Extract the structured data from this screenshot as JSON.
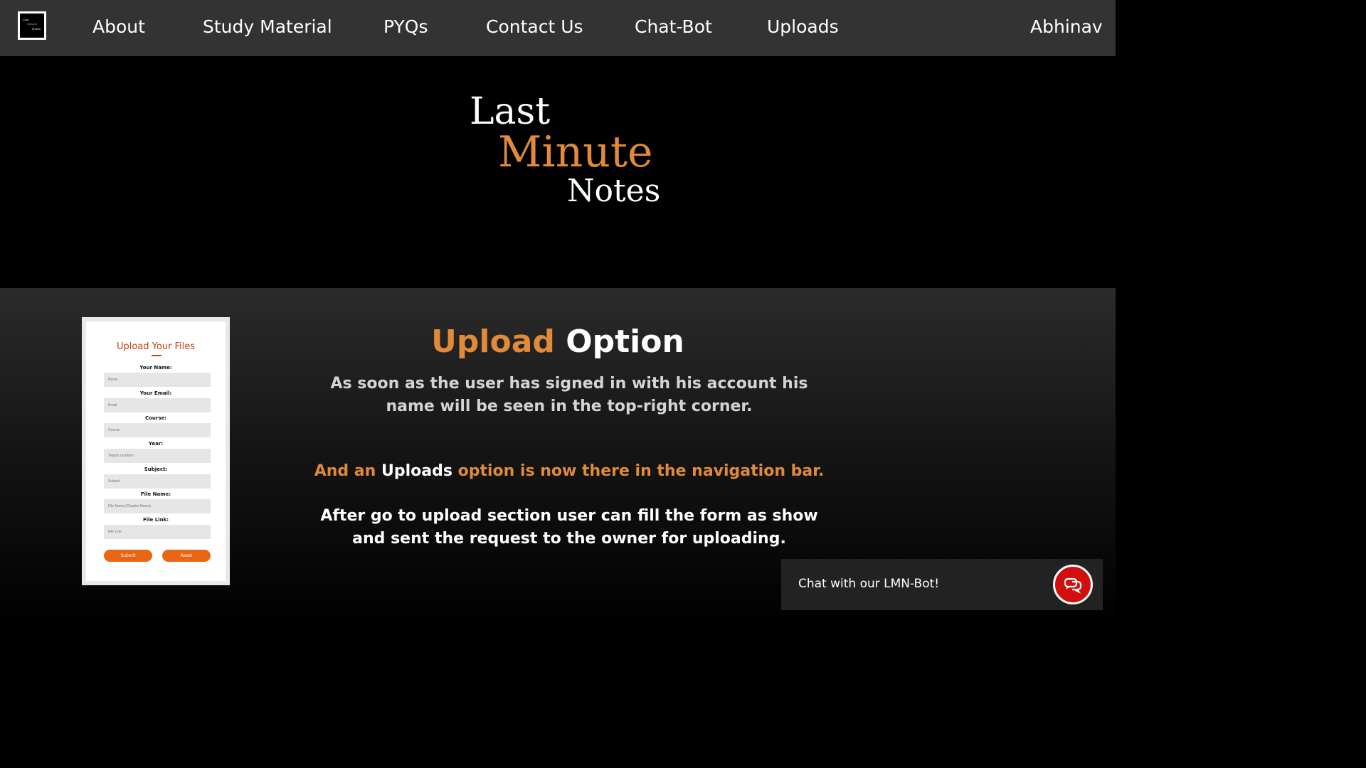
{
  "nav": {
    "logo": {
      "line1": "Last",
      "line2": "Minute",
      "line3": "Notes"
    },
    "links": [
      "About",
      "Study Material",
      "PYQs",
      "Contact Us",
      "Chat-Bot",
      "Uploads"
    ],
    "user": "Abhinav"
  },
  "hero": {
    "line1": "Last",
    "line2": "Minute",
    "line3": "Notes"
  },
  "form": {
    "title": "Upload Your Files",
    "fields": [
      {
        "label": "Your Name:",
        "placeholder": "Name"
      },
      {
        "label": "Your Email:",
        "placeholder": "Email"
      },
      {
        "label": "Course:",
        "placeholder": "Course"
      },
      {
        "label": "Year:",
        "placeholder": "Year(in number)"
      },
      {
        "label": "Subject:",
        "placeholder": "Subject"
      },
      {
        "label": "File Name:",
        "placeholder": "File Name (Chapter Name)"
      },
      {
        "label": "File Link:",
        "placeholder": "File Link"
      }
    ],
    "submit": "Submit",
    "reset": "Reset"
  },
  "section": {
    "heading_accent": "Upload",
    "heading_rest": "Option",
    "p1": "As soon as the user has signed in with his account his name will be seen in the top-right corner.",
    "p2_a": "And an",
    "p2_b": "Uploads",
    "p2_c": "option is now there in the navigation bar.",
    "p3": "After go to upload section user can fill the form as show and sent the request to the owner for uploading."
  },
  "chat": {
    "label": "Chat with our LMN-Bot!"
  },
  "colors": {
    "accent_orange": "#e08a3a",
    "nav_bg": "#333333",
    "chat_red": "#d10f0f",
    "form_btn": "#e86513"
  }
}
